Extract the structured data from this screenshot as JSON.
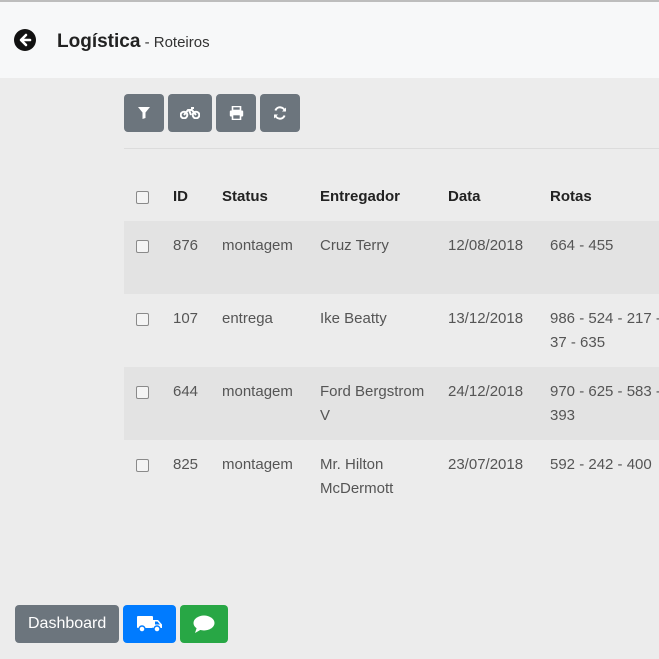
{
  "header": {
    "title": "Logística",
    "separator": " - ",
    "subtitle": "Roteiros",
    "back_icon": "arrow-left-circle-icon"
  },
  "toolbar": {
    "buttons": [
      {
        "icon": "filter-icon"
      },
      {
        "icon": "motorcycle-icon"
      },
      {
        "icon": "print-icon"
      },
      {
        "icon": "refresh-icon"
      }
    ]
  },
  "table": {
    "columns": [
      "ID",
      "Status",
      "Entregador",
      "Data",
      "Rotas"
    ],
    "rows": [
      {
        "id": "876",
        "status": "montagem",
        "entregador": "Cruz Terry",
        "data": "12/08/2018",
        "rotas": "664 - 455"
      },
      {
        "id": "107",
        "status": "entrega",
        "entregador": "Ike Beatty",
        "data": "13/12/2018",
        "rotas": "986 - 524 - 217 - 37 - 635"
      },
      {
        "id": "644",
        "status": "montagem",
        "entregador": "Ford Bergstrom V",
        "data": "24/12/2018",
        "rotas": "970 - 625 - 583 - 393"
      },
      {
        "id": "825",
        "status": "montagem",
        "entregador": "Mr. Hilton McDermott",
        "data": "23/07/2018",
        "rotas": "592 - 242 - 400"
      }
    ]
  },
  "footer": {
    "dashboard_label": "Dashboard",
    "truck_icon": "truck-icon",
    "chat_icon": "chat-bubble-icon"
  },
  "colors": {
    "gray_button": "#6c757d",
    "blue_button": "#007bff",
    "green_button": "#28a745",
    "stripe": "#e3e3e3"
  }
}
